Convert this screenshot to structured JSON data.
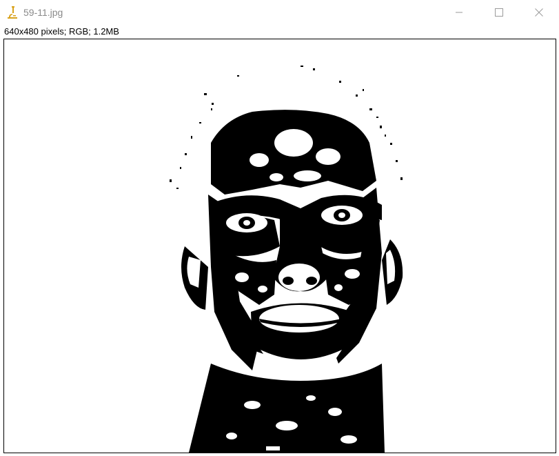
{
  "window": {
    "title": "59-11.jpg",
    "app_icon": "microscope-icon",
    "controls": {
      "minimize": "minimize-icon",
      "maximize": "maximize-icon",
      "close": "close-icon"
    }
  },
  "image_info": {
    "text": "640x480 pixels; RGB; 1.2MB"
  },
  "colors": {
    "foreground": "#000000",
    "background": "#ffffff",
    "icon_accent": "#d9a21b"
  }
}
